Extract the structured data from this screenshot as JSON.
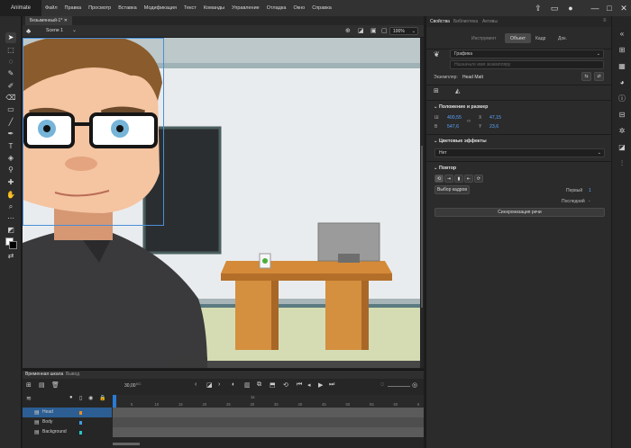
{
  "app": {
    "brand": "Animate"
  },
  "menu": [
    "Файл",
    "Правка",
    "Просмотр",
    "Вставка",
    "Модификация",
    "Текст",
    "Команды",
    "Управление",
    "Отладка",
    "Окно",
    "Справка"
  ],
  "document": {
    "tab_title": "Безымянный-1*",
    "scene": "Scene 1",
    "zoom": "100%"
  },
  "properties": {
    "tabs": [
      "Свойства",
      "Библиотека",
      "Активы"
    ],
    "mode_tabs": [
      "Инструмент",
      "Объект",
      "Кадр",
      "Док."
    ],
    "active_mode": "Объект",
    "symbol_type": "Графика",
    "instance_name_placeholder": "Назначьте имя экземпляру",
    "instance_label": "Экземпляр:",
    "instance_value": "Head Matt",
    "pos_size_title": "Положение и размер",
    "w_label": "Ш",
    "w_value": "400,55",
    "x_label": "X",
    "x_value": "47,15",
    "h_label": "В",
    "h_value": "547,6",
    "y_label": "Y",
    "y_value": "23,6",
    "color_fx_title": "Цветовые эффекты",
    "color_fx_value": "Нет",
    "loop_title": "Повтор",
    "frame_picker_button": "Выбор кадров",
    "first_label": "Первый",
    "first_value": "1",
    "last_label": "Последний",
    "last_value": "-",
    "lip_sync_button": "Синхронизация речи"
  },
  "timeline": {
    "tabs": [
      "Временная шкала",
      "Вывод"
    ],
    "fps": "30,00",
    "fps_unit": "К/С",
    "layers": [
      "Head",
      "Body",
      "Background"
    ],
    "active_layer": "Head",
    "second_marker": "1s",
    "frame_ticks": [
      "5",
      "10",
      "15",
      "20",
      "25",
      "30",
      "35",
      "40",
      "45",
      "50",
      "55",
      "60",
      "6"
    ]
  }
}
